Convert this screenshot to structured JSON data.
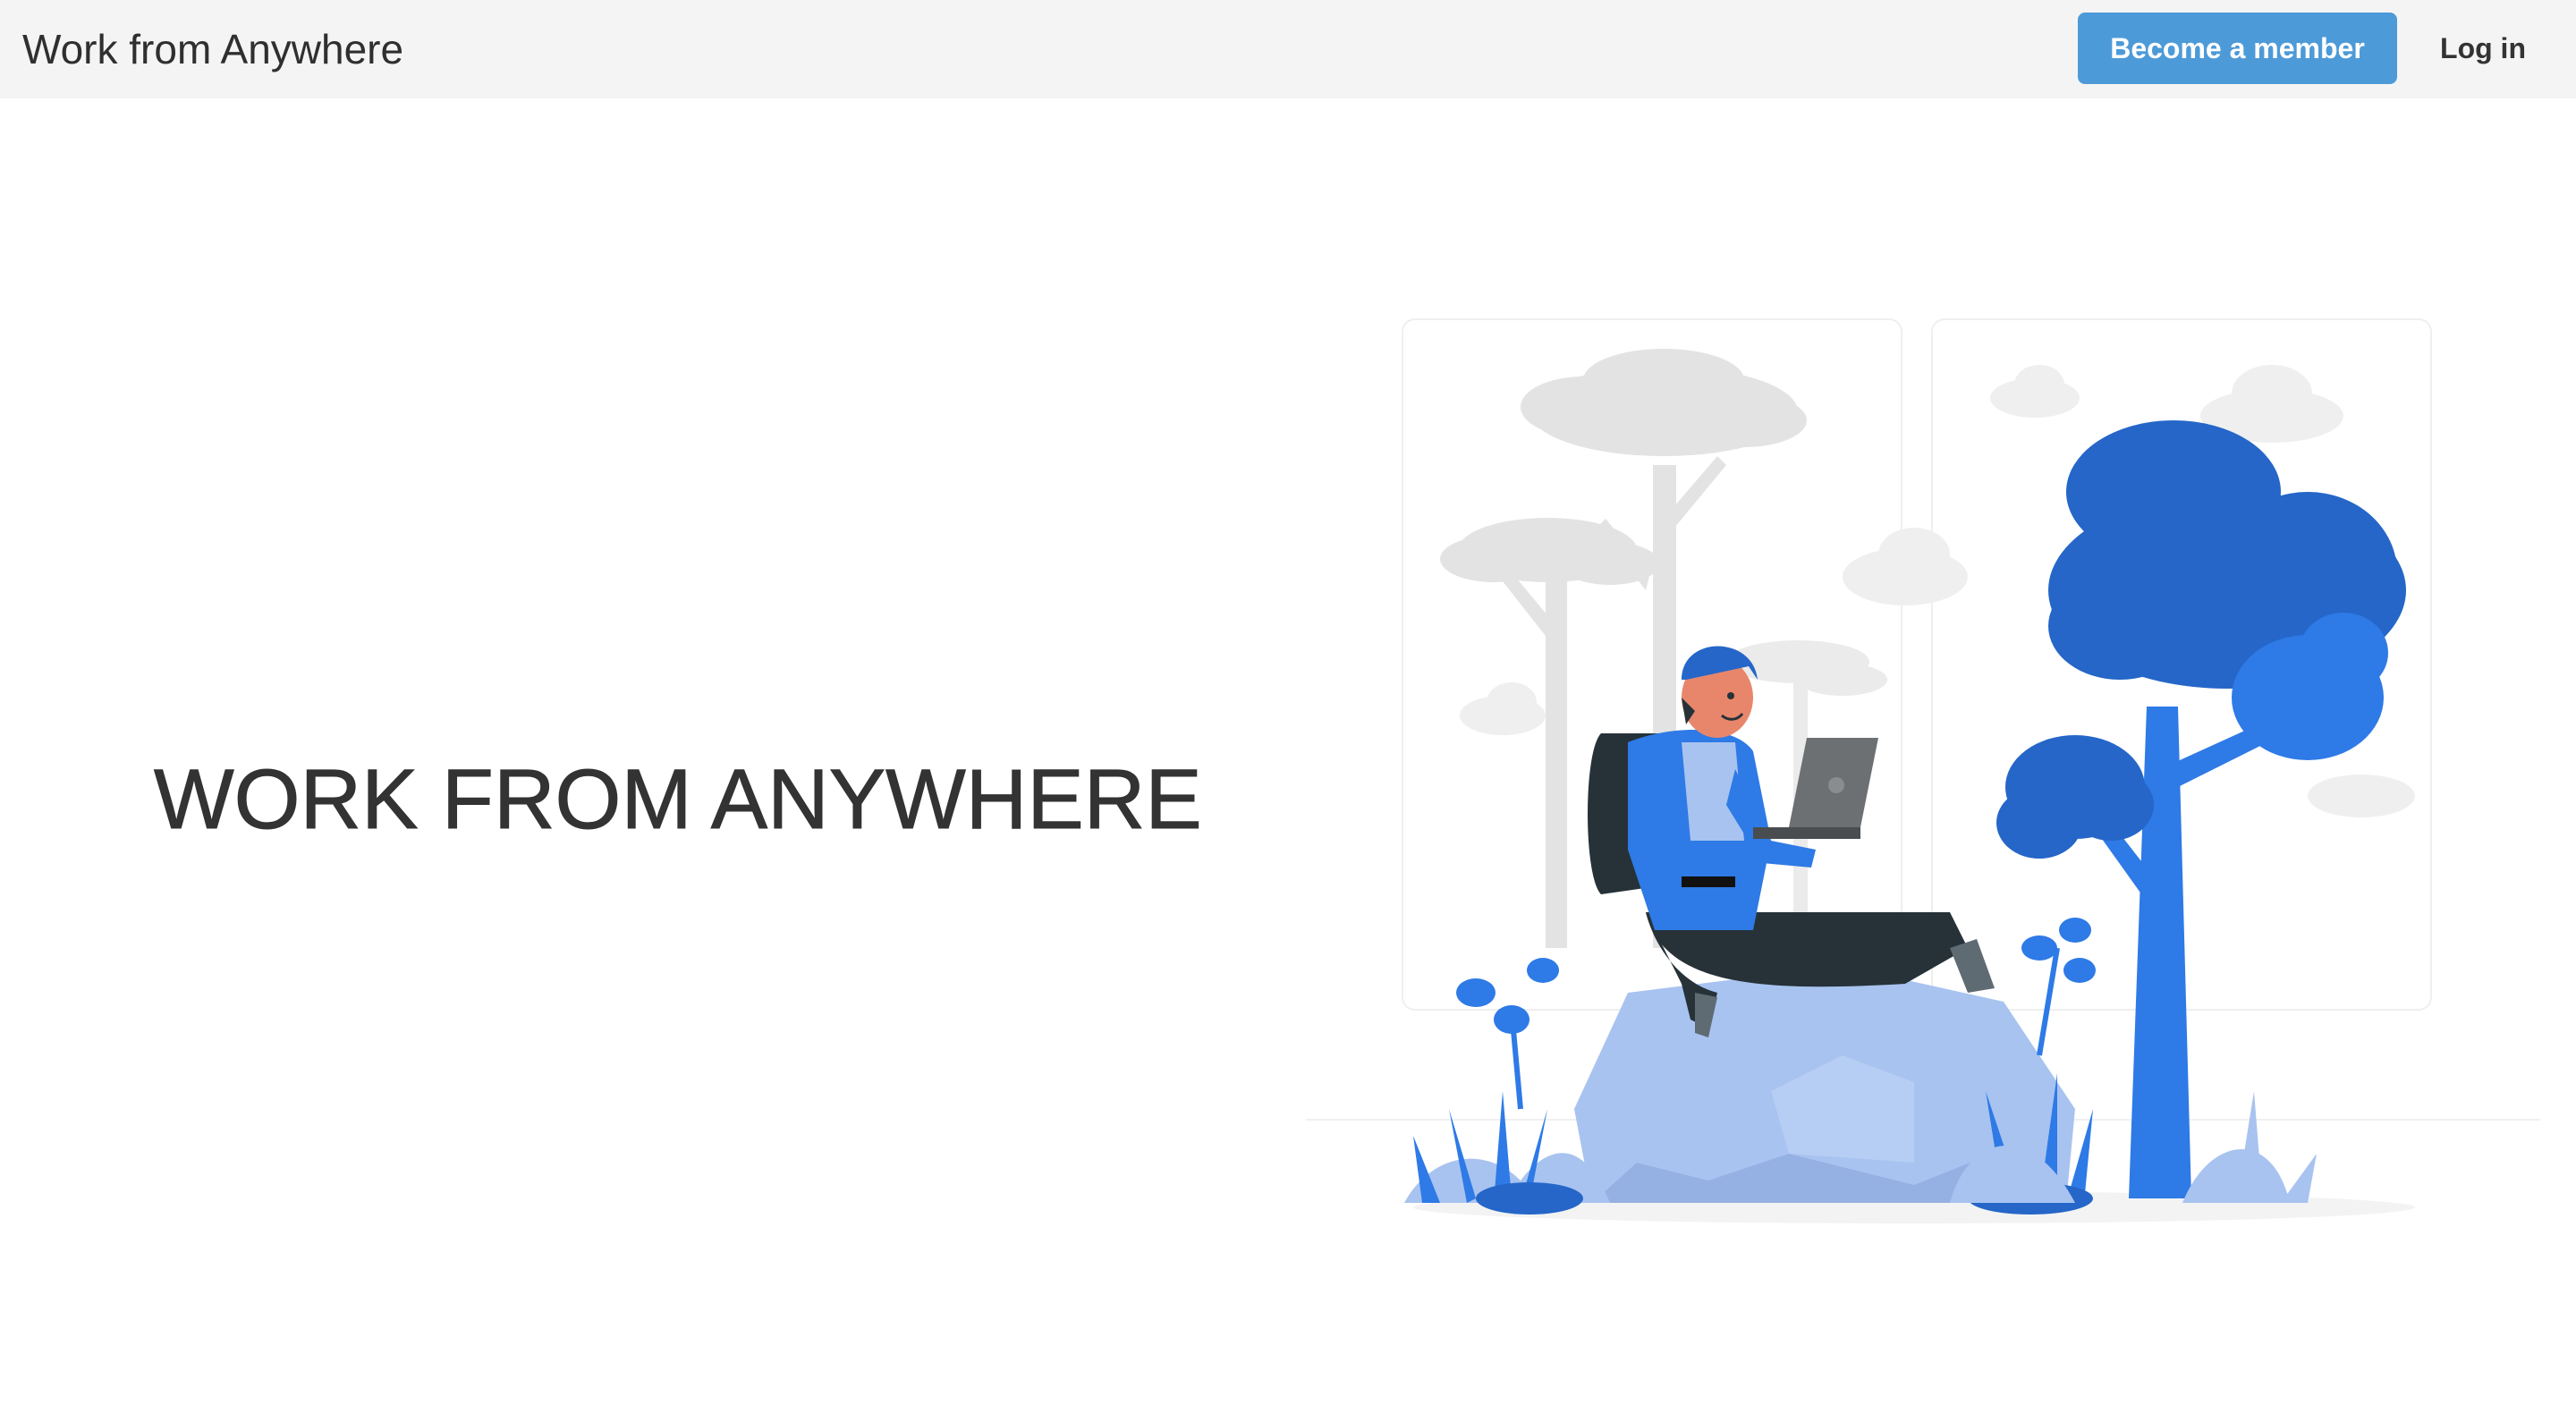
{
  "header": {
    "brand": "Work from Anywhere",
    "member_button": "Become a member",
    "login_button": "Log in"
  },
  "hero": {
    "title": "WORK FROM ANYWHERE"
  },
  "colors": {
    "nav_background": "#f4f4f4",
    "member_button_bg": "#4d9ad8",
    "illustration_blue": "#2566c8",
    "illustration_light_blue": "#a8c3f0",
    "text_dark": "#333333"
  }
}
